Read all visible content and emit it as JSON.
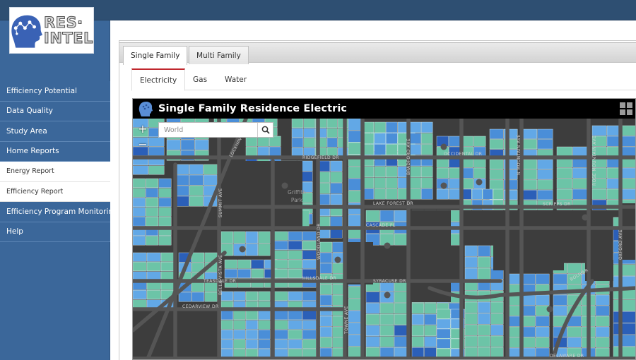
{
  "app": {
    "logo_text_line1": "RES·",
    "logo_text_line2": "INTEL"
  },
  "sidebar": {
    "items": [
      {
        "label": "Efficiency Potential",
        "type": "main"
      },
      {
        "label": "Data Quality",
        "type": "main"
      },
      {
        "label": "Study Area",
        "type": "main"
      },
      {
        "label": "Home Reports",
        "type": "main"
      },
      {
        "label": "Energy Report",
        "type": "sub"
      },
      {
        "label": "Efficiency Report",
        "type": "sub"
      },
      {
        "label": "Efficiency Program Monitoring",
        "type": "main"
      },
      {
        "label": "Help",
        "type": "main"
      }
    ]
  },
  "tabs": {
    "outer": [
      {
        "label": "Single Family",
        "active": true
      },
      {
        "label": "Multi Family",
        "active": false
      }
    ],
    "inner": [
      {
        "label": "Electricity",
        "active": true
      },
      {
        "label": "Gas",
        "active": false
      },
      {
        "label": "Water",
        "active": false
      }
    ]
  },
  "map": {
    "title": "Single Family Residence Electric",
    "search": {
      "placeholder": "World",
      "value": ""
    },
    "zoom_in": "+",
    "zoom_out": "−",
    "park_label_1": "Griffith",
    "park_label_2": "Park",
    "street_labels": [
      "LOCKHAVEN",
      "RIDGEFIELD DR",
      "OCCIDENTAL DR",
      "LAKE FOREST DR",
      "SCRIPPS DR",
      "CASCADE PL",
      "HILLSDALE DR",
      "TEASDALE DR",
      "CEDARVIEW DR",
      "SYRACUSE DR",
      "DELAWARE DR",
      "OXFORD AVE",
      "TOWNE AVE",
      "N MOUNTAIN AVE",
      "ROSE MOUNTAIN AVE",
      "BRADFORD AVE",
      "BELLA VISTA AVE",
      "WOODLAND DR",
      "SUMMIT AVE",
      "BOLIVAR"
    ],
    "colors": {
      "teal": "#6cc4a7",
      "light_blue": "#62a8e6",
      "blue": "#4a8ed8",
      "dark_blue": "#2b5fb8",
      "road": "#555555",
      "background": "#3d3d3d"
    }
  }
}
